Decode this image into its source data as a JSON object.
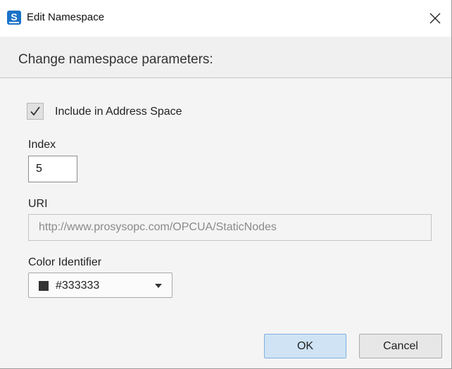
{
  "window": {
    "title": "Edit Namespace",
    "app_icon_letter": "S"
  },
  "header": {
    "title": "Change namespace parameters:"
  },
  "form": {
    "include_checkbox": {
      "label": "Include in Address Space",
      "checked": true
    },
    "index": {
      "label": "Index",
      "value": "5"
    },
    "uri": {
      "label": "URI",
      "value": "http://www.prosysopc.com/OPCUA/StaticNodes",
      "disabled": true
    },
    "color": {
      "label": "Color Identifier",
      "value": "#333333",
      "swatch": "#333333"
    }
  },
  "buttons": {
    "ok": "OK",
    "cancel": "Cancel"
  },
  "colors": {
    "accent": "#1c73c7",
    "ok_button_bg": "#cfe3f5"
  }
}
